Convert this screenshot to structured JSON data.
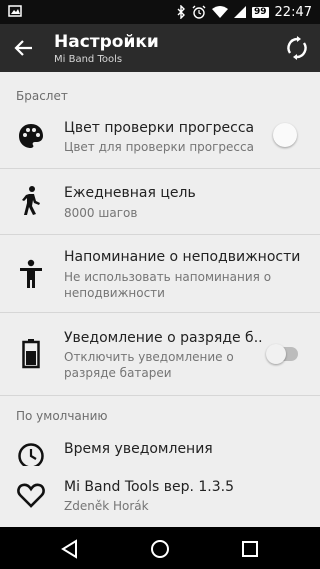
{
  "status_bar": {
    "time": "22:47",
    "battery_level": "99",
    "icons": [
      "gallery-icon",
      "bluetooth-icon",
      "alarm-icon",
      "wifi-icon",
      "signal-icon",
      "battery-icon"
    ]
  },
  "app_bar": {
    "title": "Настройки",
    "subtitle": "Mi Band Tools",
    "icons": [
      "back-arrow-icon",
      "sync-icon"
    ]
  },
  "sections": [
    {
      "header": "Браслет",
      "items": [
        {
          "title": "Цвет проверки прогресса",
          "summary": "Цвет для проверки прогресса",
          "icon": "palette-icon",
          "control": "color-circle"
        },
        {
          "title": "Ежедневная цель",
          "summary": "8000 шагов",
          "icon": "walking-icon"
        },
        {
          "title": "Напоминание о неподвижности",
          "summary_lines": [
            "Не использовать напоминания о",
            "неподвижности"
          ],
          "icon": "standing-person-icon"
        },
        {
          "title": "Уведомление о разряде б..",
          "summary_lines": [
            "Отключить уведомление о",
            "разряде батареи"
          ],
          "icon": "battery-icon",
          "control": "switch",
          "switch_on": false
        }
      ]
    },
    {
      "header": "По умолчанию",
      "items": [
        {
          "title": "Время уведомления",
          "icon": "clock-icon"
        }
      ]
    }
  ],
  "footer": {
    "title": "Mi Band Tools вер. 1.3.5",
    "author": "Zdeněk Horák",
    "icon": "heart-icon"
  },
  "nav_bar": {
    "icons": [
      "back-triangle-icon",
      "home-circle-icon",
      "recents-square-icon"
    ]
  }
}
